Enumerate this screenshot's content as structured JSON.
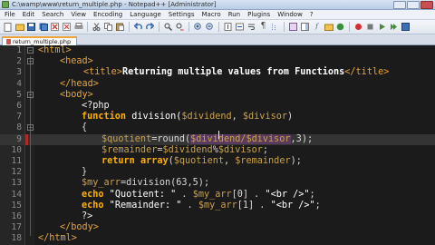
{
  "window": {
    "title": "C:\\wamp\\www\\return_multiple.php - Notepad++ [Administrator]"
  },
  "menu": [
    "File",
    "Edit",
    "Search",
    "View",
    "Encoding",
    "Language",
    "Settings",
    "Macro",
    "Run",
    "Plugins",
    "Window",
    "?"
  ],
  "toolbar_icons": [
    "new-file-icon",
    "open-icon",
    "save-icon",
    "save-all-icon",
    "close-icon",
    "close-all-icon",
    "print-icon",
    "cut-icon",
    "copy-icon",
    "paste-icon",
    "undo-icon",
    "redo-icon",
    "find-icon",
    "replace-icon",
    "zoom-in-icon",
    "zoom-out-icon",
    "sync-v-icon",
    "sync-h-icon",
    "wrap-icon",
    "all-chars-icon",
    "indent-guide-icon",
    "udl-icon",
    "doc-map-icon",
    "function-list-icon",
    "folder-icon",
    "monitor-icon",
    "record-icon",
    "stop-icon",
    "play-icon",
    "play-multi-icon",
    "save-macro-icon"
  ],
  "tab": {
    "label": "return_multiple.php"
  },
  "editor": {
    "lines": [
      {
        "n": "1"
      },
      {
        "n": "2"
      },
      {
        "n": "3"
      },
      {
        "n": "4"
      },
      {
        "n": "5"
      },
      {
        "n": "6"
      },
      {
        "n": "7"
      },
      {
        "n": "8"
      },
      {
        "n": "9"
      },
      {
        "n": "10"
      },
      {
        "n": "11"
      },
      {
        "n": "12"
      },
      {
        "n": "13"
      },
      {
        "n": "14"
      },
      {
        "n": "15"
      },
      {
        "n": "16"
      },
      {
        "n": "17"
      },
      {
        "n": "18"
      }
    ],
    "code": {
      "l1": "<html>",
      "l2": "<head>",
      "l3_open": "<title>",
      "l3_text": "Returning multiple values from Functions",
      "l3_close": "</title>",
      "l4": "</head>",
      "l5": "<body>",
      "l6": "<?php",
      "l7_kw": "function",
      "l7_rest": " division(",
      "l7_v1": "$dividend",
      "l7_mid": ", ",
      "l7_v2": "$divisor",
      "l7_end": ")",
      "l8": "{",
      "l9_v": "$quotient",
      "l9_a": "=round(",
      "l9_inner": "$dividend/$divisor",
      "l9_b": ",3);",
      "l10_v": "$remainder",
      "l10_a": "=",
      "l10_b": "$dividend",
      "l10_c": "%",
      "l10_d": "$divisor",
      "l10_e": ";",
      "l11_kw": "return",
      "l11_kw2": "array",
      "l11_a": "(",
      "l11_v1": "$quotient",
      "l11_b": ", ",
      "l11_v2": "$remainder",
      "l11_c": ");",
      "l12": "}",
      "l13_v": "$my_arr",
      "l13_a": "=division(63,5);",
      "l14_kw": "echo",
      "l14_s1": " \"Quotient: \"",
      "l14_a": " . ",
      "l14_v": "$my_arr",
      "l14_idx": "[0]",
      "l14_b": " . ",
      "l14_s2": "\"<br />\"",
      "l14_c": ";",
      "l15_kw": "echo",
      "l15_s1": " \"Remainder: \"",
      "l15_a": " . ",
      "l15_v": "$my_arr",
      "l15_idx": "[1]",
      "l15_b": " . ",
      "l15_s2": "\"<br />\"",
      "l15_c": ";",
      "l16": "?>",
      "l17": "</body>",
      "l18": "</html>"
    }
  }
}
